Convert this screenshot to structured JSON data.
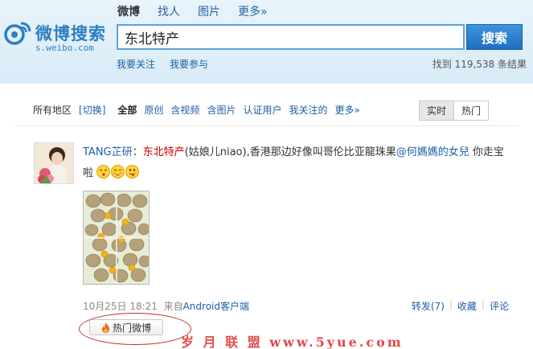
{
  "logo": {
    "text": "微博搜索",
    "url_text": "s.weibo.com"
  },
  "topnav": [
    {
      "label": "微博",
      "active": true
    },
    {
      "label": "找人",
      "active": false
    },
    {
      "label": "图片",
      "active": false
    },
    {
      "label": "更多»",
      "active": false
    }
  ],
  "search": {
    "value": "东北特产",
    "button_label": "搜索"
  },
  "sublinks": {
    "my_follows": "我要关注",
    "my_participate": "我要参与"
  },
  "result_count": "找到 119,538 条结果",
  "filters": {
    "region": "所有地区",
    "switch": "[切换]",
    "items": [
      "全部",
      "原创",
      "含视频",
      "含图片",
      "认证用户",
      "我关注的",
      "更多»"
    ]
  },
  "sort_toggle": {
    "realtime": "实时",
    "hot": "热门"
  },
  "post": {
    "user": "TANG芷研",
    "separator": "：",
    "keyword": "东北特产",
    "text_after_keyword": "(姑娘儿niao),香港那边好像叫哥伦比亚龍珠果",
    "mention": "@何媽媽的女兒",
    "tail": " 你走宝啦",
    "time": "10月25日 18:21",
    "via_prefix": "来自",
    "via": "Android客户端",
    "repost": "转发(7)",
    "favorite": "收藏",
    "comment": "评论"
  },
  "hot_button": {
    "label": "热门微博",
    "icon": "flame-icon"
  },
  "watermark": "岁 月 联 盟   www.5yue.com",
  "colors": {
    "accent": "#1d5ea8",
    "keyword": "#cc0000",
    "search_btn": "#2b80cf"
  }
}
